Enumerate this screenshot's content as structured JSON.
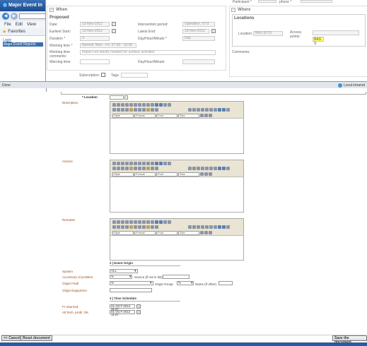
{
  "back_window": {
    "title": "Major Event In",
    "menu": [
      "File",
      "Edit",
      "View"
    ],
    "favorites_label": "Favorites",
    "content_link": "Login",
    "content_highlight": "Major Event Reports"
  },
  "dialog": {
    "participant_label": "Participant *",
    "phone_label": "phone *",
    "when_header": "When",
    "proposed_label": "Proposed",
    "date_label": "Date:",
    "date_value": "13-Nov-2012",
    "intervention_period_label": "Intervention period:",
    "intervention_period_value": "Operation, 07:0",
    "earliest_start_label": "Earliest Start:",
    "earliest_start_value": "13-Nov-2012",
    "latest_end_label": "Latest End:",
    "latest_end_value": "15-Nov-2012",
    "duration_label": "Duration *",
    "duration_value": "3",
    "day_hour_label": "Day/Hour/Minute *",
    "day_hour_value": "Day",
    "working_time_label": "Working time *",
    "working_time_value": "Normal: Mon - Fri, 07:30 - 16:30",
    "working_comments_label": "Working time comments:",
    "working_comments_value": "Impact not strictly needed for surface activities",
    "warning_time_label": "Warning time:",
    "warning_day_hour_label": "Day/Hour/Minute",
    "subscription_label": "Subscription:",
    "tags_label": "Tags:",
    "where_header": "Where",
    "locations_label": "Locations",
    "location_label": "Location:",
    "location_value": "BAS (873)",
    "access_points_label": "Access points:",
    "access_point_value": "BAS S",
    "comments_label": "Comments:"
  },
  "statusbar": {
    "left_text": "Done",
    "right_text": "Local intranet"
  },
  "form": {
    "location_label": "* Location",
    "description_label": "Description",
    "actions_label": "Actions",
    "remarks_label": "Remarks",
    "editor_dropdowns": [
      "Style",
      "Format",
      "Font",
      "Size"
    ],
    "event_origin_header": "2 | Event Origin",
    "system_label": "System",
    "system_value": "ALL",
    "accessory_label": "Accessory of problem",
    "accessory_value": "%",
    "source_label": "Source (if not in list)",
    "origin_fault_label": "Origin Fault",
    "origin_fault_value": "%",
    "origin_group_label": "Origin Group",
    "origin_group_value": "%",
    "name_label": "Name (if other)",
    "origin_equipment_label": "Origin Equipment",
    "time_schedule_header": "3 | Time Schedule",
    "fr_returned_label": "Fr returned",
    "fr_returned_value": "01-OCT-2012 11:07",
    "all_tech_label": "All Tech. probl. OK",
    "all_tech_value": "01-OCT-2012 11:07",
    "cancel_button": "<< Cancel",
    "reset_button": "Reset document",
    "save_button": "Save the document"
  }
}
